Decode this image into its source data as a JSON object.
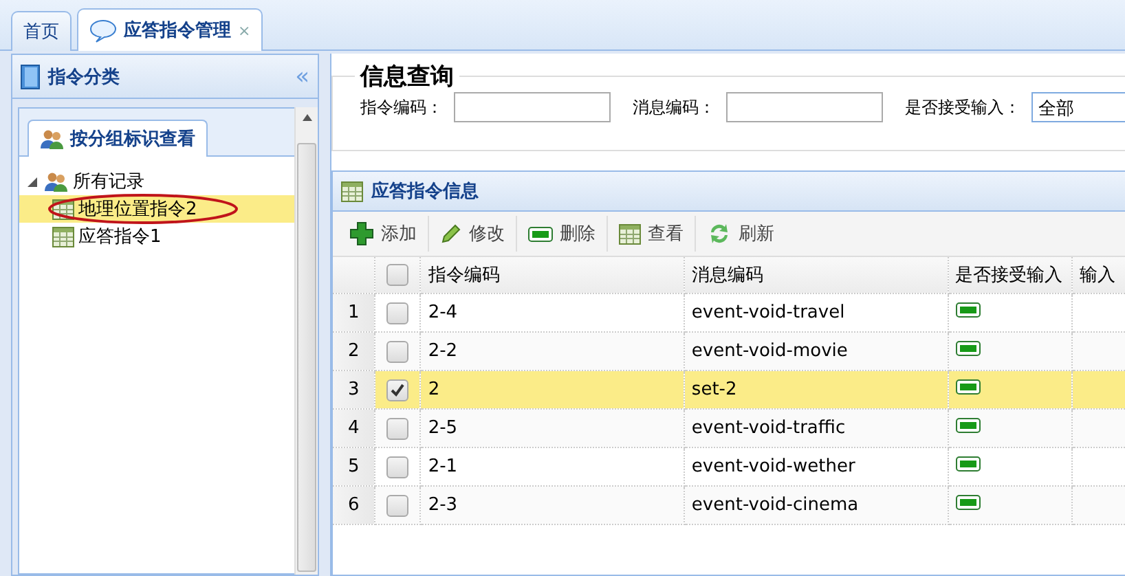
{
  "tabs": [
    {
      "label": "首页",
      "selected": false,
      "closable": false
    },
    {
      "label": "应答指令管理",
      "selected": true,
      "closable": true,
      "close": "×"
    }
  ],
  "sidebar": {
    "title": "指令分类",
    "collapse": "«",
    "tabs": [
      {
        "label": "按分组标识查看",
        "selected": true
      }
    ],
    "tree": [
      {
        "label": "所有记录",
        "expanded": true,
        "selected": false,
        "children": [
          {
            "label": "地理位置指令2",
            "selected": true,
            "annotated": true
          },
          {
            "label": "应答指令1",
            "selected": false,
            "annotated": false
          }
        ]
      }
    ]
  },
  "query": {
    "title": "信息查询",
    "fields": [
      {
        "kind": "text",
        "label": "指令编码："
      },
      {
        "kind": "text",
        "label": "消息编码："
      },
      {
        "kind": "select",
        "label": "是否接受输入：",
        "value": "全部"
      }
    ]
  },
  "grid": {
    "title": "应答指令信息",
    "toolbar": [
      {
        "kind": "add",
        "label": "添加"
      },
      {
        "kind": "edit",
        "label": "修改"
      },
      {
        "kind": "delete",
        "label": "删除"
      },
      {
        "kind": "view",
        "label": "查看"
      },
      {
        "kind": "refresh",
        "label": "刷新"
      }
    ],
    "columns": [
      "指令编码",
      "消息编码",
      "是否接受输入",
      "输入"
    ],
    "header_checked": false,
    "rows": [
      {
        "num": "1",
        "checked": false,
        "selected": false,
        "code": "2-4",
        "message": "event-void-travel"
      },
      {
        "num": "2",
        "checked": false,
        "selected": false,
        "code": "2-2",
        "message": "event-void-movie"
      },
      {
        "num": "3",
        "checked": true,
        "selected": true,
        "code": "2",
        "message": "set-2"
      },
      {
        "num": "4",
        "checked": false,
        "selected": false,
        "code": "2-5",
        "message": "event-void-traffic"
      },
      {
        "num": "5",
        "checked": false,
        "selected": false,
        "code": "2-1",
        "message": "event-void-wether"
      },
      {
        "num": "6",
        "checked": false,
        "selected": false,
        "code": "2-3",
        "message": "event-void-cinema"
      }
    ]
  }
}
